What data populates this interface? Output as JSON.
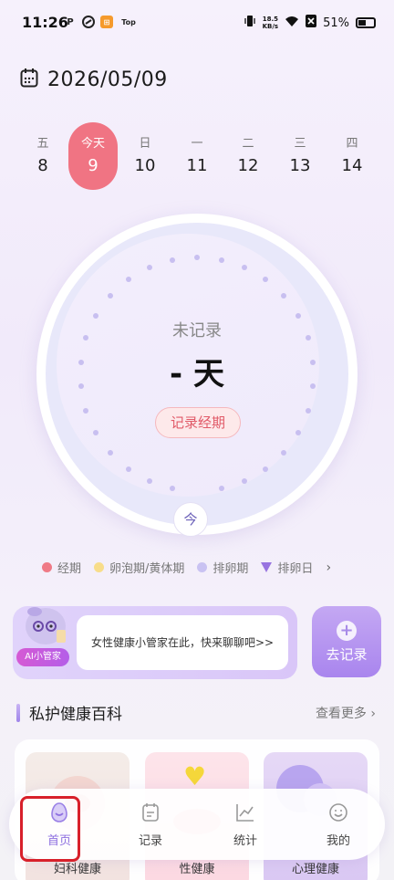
{
  "status_bar": {
    "time": "11:26",
    "left_icons": [
      "P",
      "app-icon",
      "top-icon"
    ],
    "top_label": "Top",
    "net_speed_value": "18.5",
    "net_speed_unit": "KB/s",
    "battery": "51%"
  },
  "header": {
    "date": "2026/05/09"
  },
  "week": [
    {
      "weekday": "五",
      "day": "8"
    },
    {
      "weekday": "今天",
      "day": "9",
      "today": true
    },
    {
      "weekday": "日",
      "day": "10"
    },
    {
      "weekday": "一",
      "day": "11"
    },
    {
      "weekday": "二",
      "day": "12"
    },
    {
      "weekday": "三",
      "day": "13"
    },
    {
      "weekday": "四",
      "day": "14"
    }
  ],
  "cycle": {
    "status": "未记录",
    "days": "- 天",
    "record_button": "记录经期",
    "today_marker": "今"
  },
  "legend": {
    "items": [
      {
        "label": "经期",
        "color": "#ef7a86"
      },
      {
        "label": "卵泡期/黄体期",
        "color": "#f8dd8a"
      },
      {
        "label": "排卵期",
        "color": "#c9c2f2"
      },
      {
        "label": "排卵日",
        "color": "#9874e0"
      }
    ]
  },
  "ai_card": {
    "badge": "AI小管家",
    "message": "女性健康小管家在此，快来聊聊吧>>"
  },
  "go_record": {
    "label": "去记录"
  },
  "wiki": {
    "title": "私护健康百科",
    "more": "查看更多",
    "cards": [
      {
        "label": "妇科健康"
      },
      {
        "label": "性健康"
      },
      {
        "label": "心理健康"
      }
    ]
  },
  "bottom_nav": {
    "items": [
      {
        "label": "首页",
        "icon": "home-egg-icon",
        "active": true
      },
      {
        "label": "记录",
        "icon": "calendar-note-icon"
      },
      {
        "label": "统计",
        "icon": "chart-icon"
      },
      {
        "label": "我的",
        "icon": "smile-face-icon"
      }
    ]
  },
  "colors": {
    "accent": "#8d6fe0",
    "period": "#f07483",
    "highlight_box": "#d8202a"
  }
}
